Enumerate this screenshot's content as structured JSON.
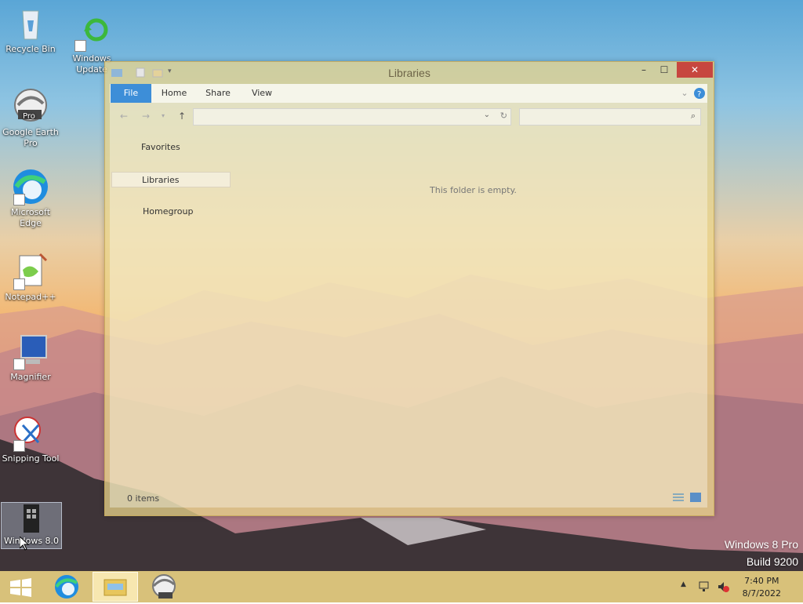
{
  "desktop": {
    "icons": [
      {
        "label": "Recycle Bin",
        "icon": "recycle-bin-icon"
      },
      {
        "label": "Windows Update",
        "icon": "windows-update-icon"
      },
      {
        "label": "Google Earth Pro",
        "icon": "google-earth-icon",
        "badge": "Pro"
      },
      {
        "label": "Microsoft Edge",
        "icon": "edge-icon"
      },
      {
        "label": "Notepad++",
        "icon": "notepadpp-icon"
      },
      {
        "label": "Magnifier",
        "icon": "magnifier-icon"
      },
      {
        "label": "Snipping Tool",
        "icon": "snipping-tool-icon"
      },
      {
        "label": "Windows 8.0",
        "icon": "windows-8-icon"
      }
    ],
    "watermark": {
      "line1": "Windows 8 Pro",
      "line2": "Build 9200"
    }
  },
  "window": {
    "title": "Libraries",
    "ribbon_tabs": {
      "file": "File",
      "home": "Home",
      "share": "Share",
      "view": "View"
    },
    "nav": {
      "favorites": "Favorites",
      "libraries": "Libraries",
      "homegroup": "Homegroup"
    },
    "empty_message": "This folder is empty.",
    "status": "0 items",
    "controls": {
      "minimize": "–",
      "maximize": "☐",
      "close": "✕"
    }
  },
  "taskbar": {
    "items": [
      "start-icon",
      "edge-icon",
      "file-explorer-icon",
      "google-earth-icon"
    ],
    "clock": {
      "time": "7:40 PM",
      "date": "8/7/2022"
    }
  },
  "colors": {
    "accent": "#3d8ed8",
    "window_tint": "#e9d48b",
    "close": "#c7463f"
  }
}
